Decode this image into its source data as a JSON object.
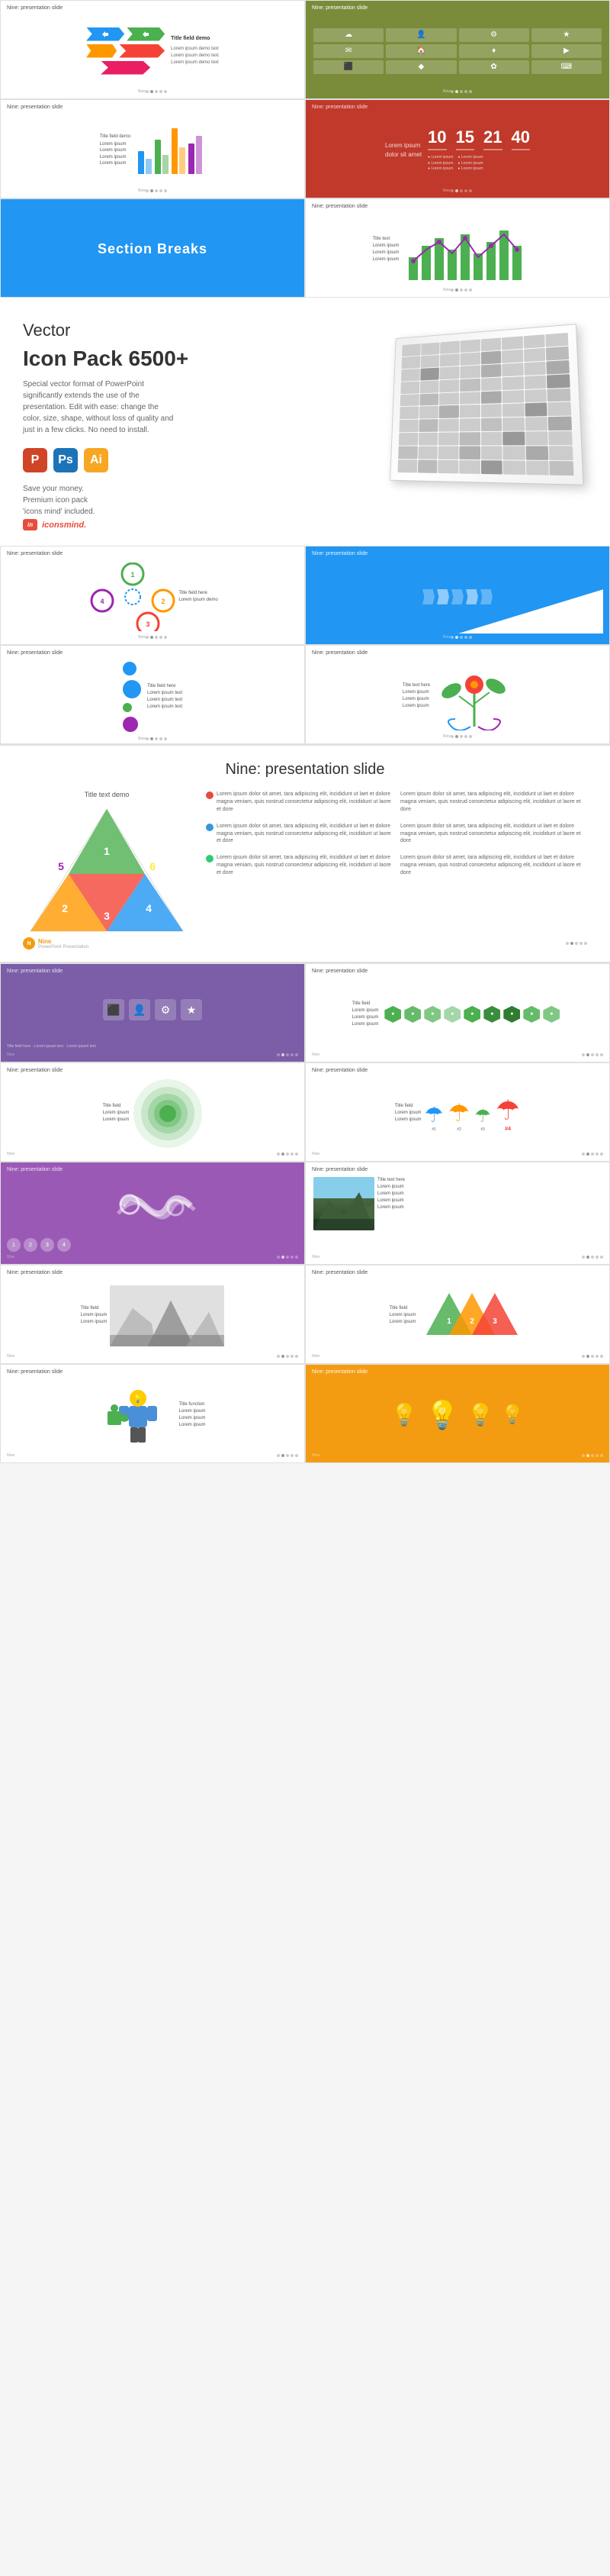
{
  "slides": {
    "row1": {
      "s1": {
        "title": "Nine: presentation slide",
        "arrows": [
          "#2196F3",
          "#4CAF50",
          "#FF9800"
        ]
      },
      "s2": {
        "title": "Nine: presentation slide",
        "bg": "#7a8c3a"
      },
      "s3": {
        "title": "Nine: presentation slide",
        "bars": [
          {
            "color": "#2196F3",
            "height": 60
          },
          {
            "color": "#4CAF50",
            "height": 45
          },
          {
            "color": "#FF9800",
            "height": 70
          },
          {
            "color": "#9C27B0",
            "height": 55
          },
          {
            "color": "#F44336",
            "height": 40
          }
        ]
      },
      "s4": {
        "title": "Nine: presentation slide",
        "bg": "#c0392b",
        "nums": [
          "10",
          "15",
          "21",
          "40"
        ]
      }
    },
    "row2": {
      "s5": {
        "label": "Section Breaks",
        "bg": "#2196F3"
      },
      "s6": {
        "title": "Nine: presentation slide"
      }
    }
  },
  "promo": {
    "line1": "Vector",
    "line2": "Icon Pack 6500+",
    "desc": "Special vector format of PowerPoint significantly extends the use of the presentation. Edit with ease: change the color, size, shape, without loss of quality and just in a few clicks. No need to install.",
    "apps": [
      "P",
      "Ps",
      "Ai"
    ],
    "save_label": "Save your money.",
    "premium_label": "Premium icon pack",
    "icons_label": "'icons mind' included.",
    "brand_in": "in",
    "brand_name": "iconsmind."
  },
  "mid_slides": {
    "s1": {
      "title": "Nine: presentation slide",
      "type": "cycle"
    },
    "s2": {
      "title": "Nine: presentation slide",
      "type": "arrows_blue",
      "bg": "#2196F3"
    },
    "s3": {
      "title": "Nine: presentation slide",
      "type": "dots"
    },
    "s4": {
      "title": "Nine: presentation slide",
      "type": "plant"
    }
  },
  "featured": {
    "title": "Nine: presentation slide",
    "sub": "Title text demo",
    "logo": "Nine",
    "sub_logo": "PowerPoint Presentation",
    "nums": [
      "1",
      "2",
      "3",
      "4",
      "5",
      "6"
    ],
    "colors": [
      "#4CAF50",
      "#FF9800",
      "#2196F3",
      "#F44336",
      "#9C27B0",
      "#FFEB3B"
    ],
    "text_blocks": [
      "Lorem ipsum dolor sit amet, tara adipiscing elit, incididunt ut laet et dolore magna veniam, quis nostrud consectetur adipiscing elit, incididunt ut laore et dore",
      "Lorem ipsum dolor sit amet, tara adipiscing elit, incididunt ut laet et dolore magna veniam, quis nostrud consectetur adipiscing elit, incididunt ut laore et dore",
      "Lorem ipsum dolor sit amet, tara adipiscing elit, incididunt ut laet et dolore magna veniam, quis nostrud consectetur adipiscing elit, incididunt ut laore et dore",
      "Lorem ipsum dolor sit amet, tara adipiscing elit, incididunt ut laet et dolore magna veniam, quis nostrud consectetur adipiscing elit, incididunt ut laore et dore"
    ],
    "dot_colors": [
      "#e74c3c",
      "#3498db",
      "#2ecc71"
    ]
  },
  "lower_slides": {
    "row1": {
      "s1": {
        "title": "Nine: presentation slide",
        "bg": "#7b5ea7",
        "type": "icons_purple"
      },
      "s2": {
        "title": "Nine: presentation slide",
        "type": "hex_green"
      }
    },
    "row2": {
      "s1": {
        "title": "Nine: presentation slide",
        "type": "nested_circles"
      },
      "s2": {
        "title": "Nine: presentation slide",
        "type": "umbrellas"
      }
    },
    "row3": {
      "s1": {
        "title": "Nine: presentation slide",
        "bg": "#9b59b6",
        "type": "swirls"
      },
      "s2": {
        "title": "Nine: presentation slide",
        "type": "mountain"
      }
    },
    "row4": {
      "s1": {
        "title": "Nine: presentation slide",
        "type": "triangles_gray"
      },
      "s2": {
        "title": "Nine: presentation slide",
        "type": "triangles_color"
      }
    },
    "row5": {
      "s1": {
        "title": "Nine: presentation slide",
        "type": "puzzle"
      },
      "s2": {
        "title": "Nine: presentation slide",
        "bg": "#f39c12",
        "type": "bulbs"
      }
    }
  },
  "footer_dots": [
    "d",
    "d",
    "d",
    "d",
    "d"
  ]
}
